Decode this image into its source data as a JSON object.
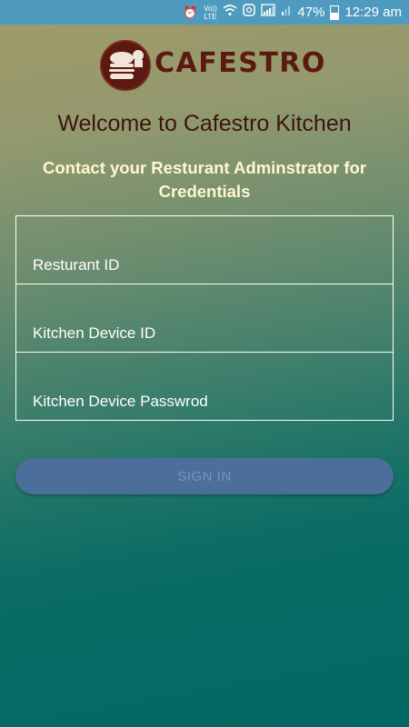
{
  "status_bar": {
    "network_label": "Vo)) LTE",
    "battery": "47%",
    "time": "12:29 am",
    "icons": [
      "alarm-icon",
      "wifi-icon",
      "data-saver-icon",
      "signal-icon",
      "signal-2-icon",
      "battery-icon"
    ]
  },
  "logo": {
    "text": "CAFESTRO"
  },
  "welcome_title": "Welcome to Cafestro Kitchen",
  "subtitle": "Contact your Resturant Adminstrator for Credentials",
  "form": {
    "restaurant_id_placeholder": "Resturant ID",
    "kitchen_device_id_placeholder": "Kitchen Device ID",
    "kitchen_device_password_placeholder": "Kitchen Device Passwrod"
  },
  "signin_label": "SIGN IN",
  "colors": {
    "status_bar": "#4f9bbf",
    "title": "#3d1410",
    "subtitle": "#fff8cf",
    "button": "#4b6e9a",
    "button_text": "#7e93b4"
  }
}
